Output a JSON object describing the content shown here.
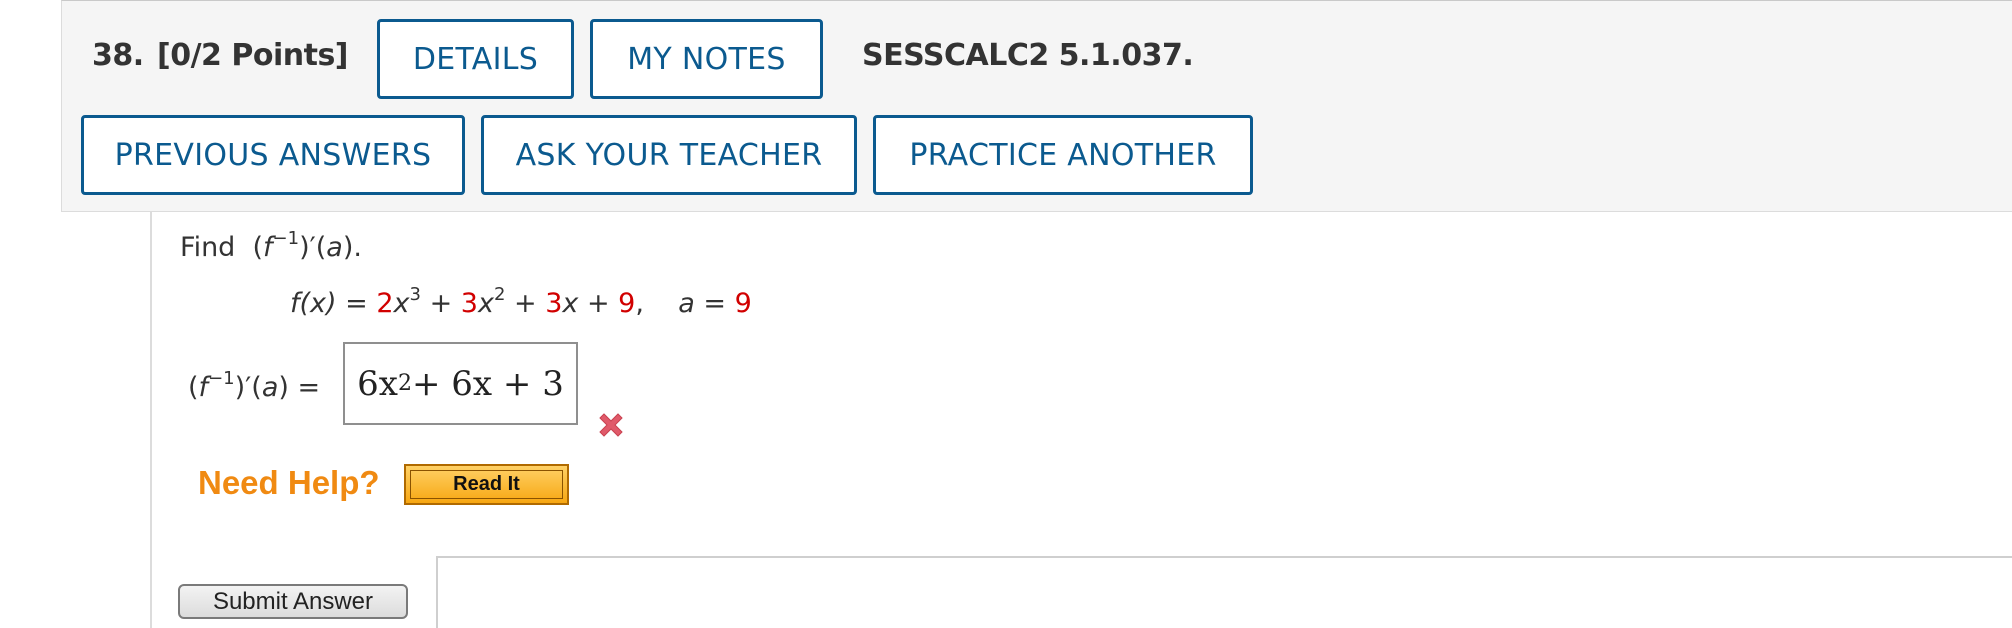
{
  "question": {
    "number": "38.",
    "points": "[0/2 Points]",
    "code": "SESSCALC2 5.1.037."
  },
  "buttons": {
    "details": "DETAILS",
    "my_notes": "MY NOTES",
    "previous_answers": "PREVIOUS ANSWERS",
    "ask_teacher": "ASK YOUR TEACHER",
    "practice_another": "PRACTICE ANOTHER"
  },
  "problem": {
    "prompt_word": "Find",
    "function_lhs": "f(x)",
    "coef1": "2",
    "coef2": "3",
    "coef3": "3",
    "const": "9",
    "a_value": "9"
  },
  "answer": {
    "base": "6x",
    "exponent": "2",
    "rest": " + 6x + 3",
    "status_icon": "incorrect-x-icon",
    "status_color": "#e05a6a"
  },
  "help": {
    "need_help": "Need Help?",
    "read_it": "Read It"
  },
  "submit": {
    "label": "Submit Answer"
  },
  "colors": {
    "accent": "#0b5a8f",
    "given_values": "#d10000",
    "help_orange": "#f08a12"
  }
}
